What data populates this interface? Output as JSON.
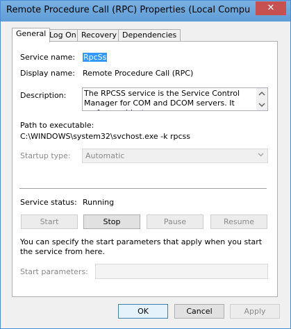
{
  "window": {
    "title": "Remote Procedure Call (RPC) Properties (Local Compu",
    "close_glyph": "✕"
  },
  "tabs": [
    {
      "label": "General"
    },
    {
      "label": "Log On"
    },
    {
      "label": "Recovery"
    },
    {
      "label": "Dependencies"
    }
  ],
  "general": {
    "service_name_label": "Service name:",
    "service_name_value": "RpcSs",
    "display_name_label": "Display name:",
    "display_name_value": "Remote Procedure Call (RPC)",
    "description_label": "Description:",
    "description_value": "The RPCSS service is the Service Control Manager for COM and DCOM servers. It performs object",
    "path_label": "Path to executable:",
    "path_value": "C:\\WINDOWS\\system32\\svchost.exe -k rpcss",
    "startup_type_label": "Startup type:",
    "startup_type_value": "Automatic",
    "status_label": "Service status:",
    "status_value": "Running",
    "start_button": "Start",
    "stop_button": "Stop",
    "pause_button": "Pause",
    "resume_button": "Resume",
    "params_note": "You can specify the start parameters that apply when you start the service from here.",
    "start_params_label": "Start parameters:",
    "start_params_value": ""
  },
  "footer": {
    "ok": "OK",
    "cancel": "Cancel",
    "apply": "Apply"
  }
}
